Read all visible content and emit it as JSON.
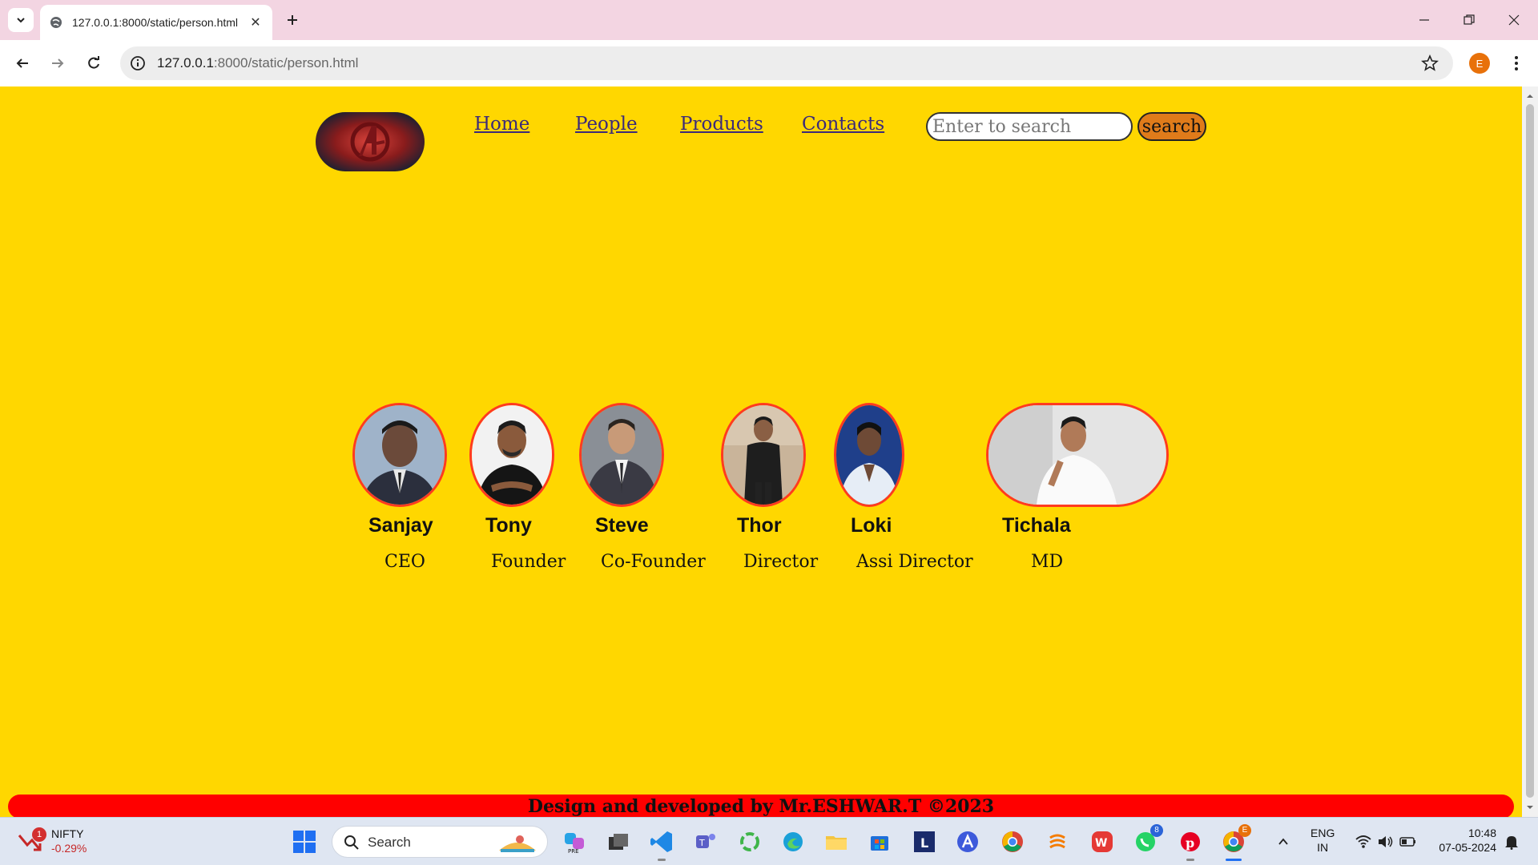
{
  "browser": {
    "tab_title": "127.0.0.1:8000/static/person.html",
    "url_host": "127.0.0.1",
    "url_rest": ":8000/static/person.html",
    "profile_initial": "E"
  },
  "page": {
    "nav": [
      {
        "label": "Home"
      },
      {
        "label": "People"
      },
      {
        "label": "Products"
      },
      {
        "label": "Contacts"
      }
    ],
    "search": {
      "placeholder": "Enter to search",
      "button_label": "search"
    },
    "people": [
      {
        "name": "Sanjay",
        "role": "CEO"
      },
      {
        "name": "Tony",
        "role": "Founder"
      },
      {
        "name": "Steve",
        "role": "Co-Founder"
      },
      {
        "name": "Thor",
        "role": "Director"
      },
      {
        "name": "Loki",
        "role": "Assi Director"
      },
      {
        "name": "Tichala",
        "role": "MD"
      }
    ],
    "footer": "Design and developed by Mr.ESHWAR.T ©2023"
  },
  "colors": {
    "page_bg": "#ffd700",
    "photo_border": "#ff3b1f",
    "footer_bg": "#ff0000",
    "search_button": "#e07b1a",
    "nav_link": "#3b2a7a"
  },
  "taskbar": {
    "ticker_badge": "1",
    "ticker_name": "NIFTY",
    "ticker_change": "-0.29%",
    "search_label": "Search",
    "whatsapp_badge": "8",
    "chrome_badge": "E",
    "lang_line1": "ENG",
    "lang_line2": "IN",
    "time": "10:48",
    "date": "07-05-2024"
  }
}
